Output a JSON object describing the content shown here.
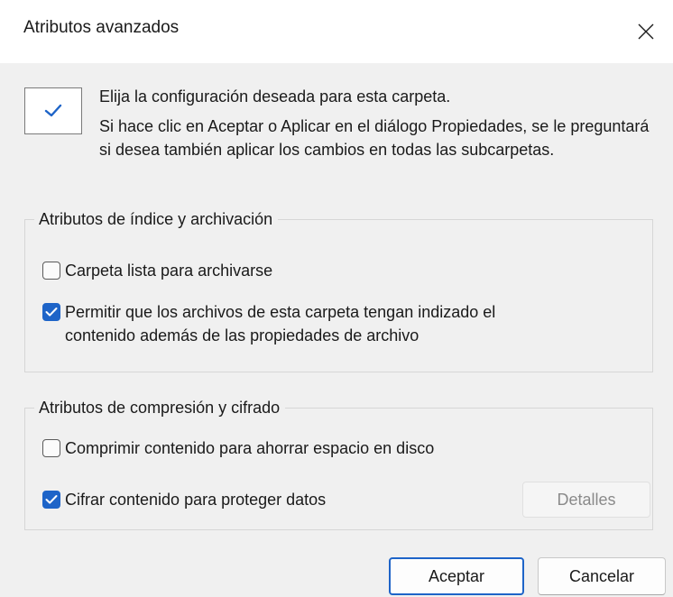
{
  "window": {
    "title": "Atributos avanzados",
    "close_icon": "close-icon"
  },
  "intro": {
    "icon": "folder-settings-check-icon",
    "lead": "Elija la configuración deseada para esta carpeta.",
    "body": "Si hace clic en Aceptar o Aplicar en el diálogo Propiedades, se le preguntará si desea también aplicar los cambios en todas las subcarpetas."
  },
  "index_group": {
    "legend": "Atributos de índice y archivación",
    "archive": {
      "label": "Carpeta lista para archivarse",
      "checked": false
    },
    "indexing": {
      "label_line1": "Permitir que los archivos de esta carpeta tengan indizado el",
      "label_line2": "contenido además de las propiedades de archivo",
      "checked": true
    }
  },
  "compress_group": {
    "legend": "Atributos de compresión y cifrado",
    "compress": {
      "label": "Comprimir contenido para ahorrar espacio en disco",
      "checked": false
    },
    "encrypt": {
      "label": "Cifrar contenido para proteger datos",
      "checked": true
    },
    "details_label": "Detalles"
  },
  "buttons": {
    "ok_label": "Aceptar",
    "cancel_label": "Cancelar"
  },
  "colors": {
    "accent": "#1e64c8",
    "dialog_bg": "#f0f0f0",
    "titlebar_bg": "#ffffff",
    "disabled_text": "#8a8a8a"
  }
}
